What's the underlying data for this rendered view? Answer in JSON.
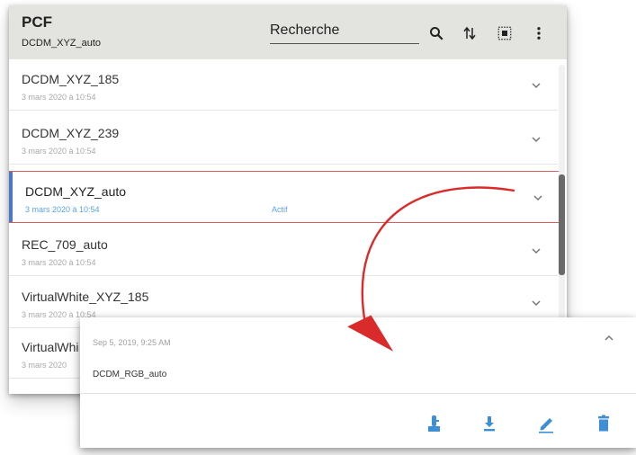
{
  "header": {
    "title": "PCF",
    "subtitle": "DCDM_XYZ_auto",
    "search_placeholder": "Recherche",
    "icons": [
      "search-icon",
      "sort-icon",
      "select-all-icon",
      "more-vert-icon"
    ]
  },
  "list": {
    "items": [
      {
        "name": "DCDM_XYZ_185",
        "date": "3 mars 2020 à 10:54",
        "status": ""
      },
      {
        "name": "DCDM_XYZ_239",
        "date": "3 mars 2020 à 10:54",
        "status": ""
      },
      {
        "name": "DCDM_XYZ_auto",
        "date": "3 mars 2020 à 10:54",
        "status": "Actif"
      },
      {
        "name": "REC_709_auto",
        "date": "3 mars 2020 à 10:54",
        "status": ""
      },
      {
        "name": "VirtualWhite_XYZ_185",
        "date": "3 mars 2020 à 10:54",
        "status": ""
      },
      {
        "name": "VirtualWhi",
        "date": "3 mars 2020",
        "status": ""
      }
    ]
  },
  "detail": {
    "date": "Sep 5, 2019, 9:25 AM",
    "name": "DCDM_RGB_auto",
    "actions": [
      "install-icon",
      "download-icon",
      "edit-icon",
      "delete-icon"
    ]
  },
  "colors": {
    "header_bg": "#e3e3e0",
    "accent_blue": "#3f8fd6",
    "active_border": "#e05a5a",
    "arrow_red": "#d92b2b"
  }
}
